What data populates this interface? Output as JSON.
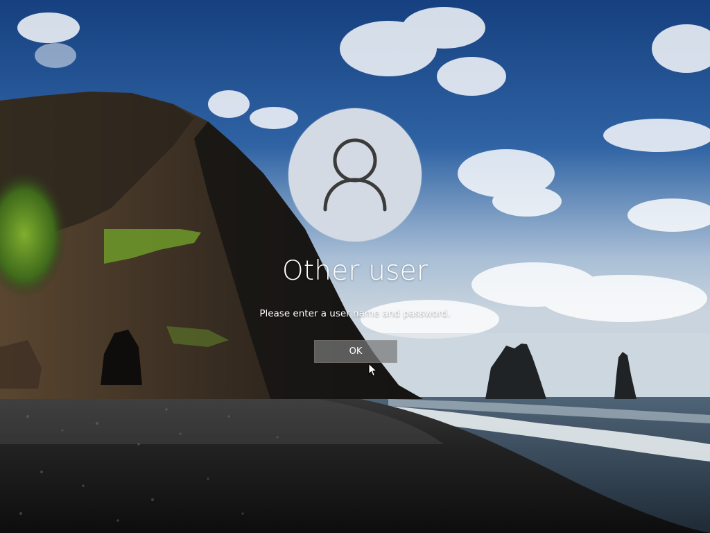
{
  "lock_screen": {
    "user_name": "Other user",
    "message": "Please enter a user name and password.",
    "ok_label": "OK"
  },
  "colors": {
    "avatar_bg": "#d3dae3",
    "avatar_glyph": "#3b3b3b",
    "button_bg": "#787878",
    "text": "#ffffff"
  },
  "icons": {
    "avatar": "user-icon",
    "pointer": "mouse-cursor-icon"
  }
}
